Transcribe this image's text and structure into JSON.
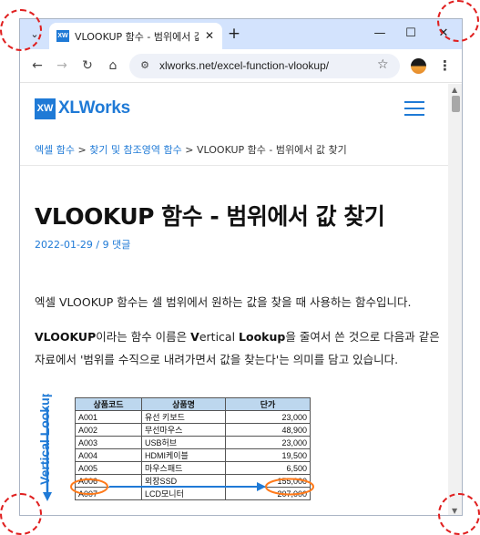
{
  "browser": {
    "tab_title": "VLOOKUP 함수 - 범위에서 값 찾기 - XLWorks",
    "favicon_text": "XW",
    "url": "xlworks.net/excel-function-vlookup/"
  },
  "site": {
    "logo_mark": "XW",
    "logo_text": "XLWorks",
    "brand_color": "#1f7ad6"
  },
  "breadcrumb": {
    "item1": "엑셀 함수",
    "sep1": " > ",
    "item2": "찾기 및 참조영역 함수",
    "sep2": " > ",
    "current": "VLOOKUP 함수 - 범위에서 값 찾기"
  },
  "article": {
    "title": "VLOOKUP 함수 - 범위에서 값 찾기",
    "meta": "2022-01-29 / 9 댓글",
    "para1": "엑셀 VLOOKUP 함수는 셀 범위에서 원하는 값을 찾을 때 사용하는 함수입니다.",
    "para2_b1": "VLOOKUP",
    "para2_t1": "이라는 함수 이름은 ",
    "para2_b2": "V",
    "para2_t2": "ertical ",
    "para2_b3": "Lookup",
    "para2_t3": "을 줄여서 쓴 것으로 다음과 같은",
    "para3": "자료에서 '범위를 수직으로 내려가면서 값을 찾는다'는 의미를 담고 있습니다."
  },
  "figure": {
    "vertical_label": "Vertical Lookup",
    "headers": [
      "상품코드",
      "상품명",
      "단가"
    ],
    "rows": [
      [
        "A001",
        "유선 키보드",
        "23,000"
      ],
      [
        "A002",
        "무선마우스",
        "48,900"
      ],
      [
        "A003",
        "USB허브",
        "23,000"
      ],
      [
        "A004",
        "HDMI케이블",
        "19,500"
      ],
      [
        "A005",
        "마우스패드",
        "6,500"
      ],
      [
        "A006",
        "외장SSD",
        "155,000"
      ],
      [
        "A007",
        "LCD모니터",
        "207,000"
      ]
    ]
  }
}
